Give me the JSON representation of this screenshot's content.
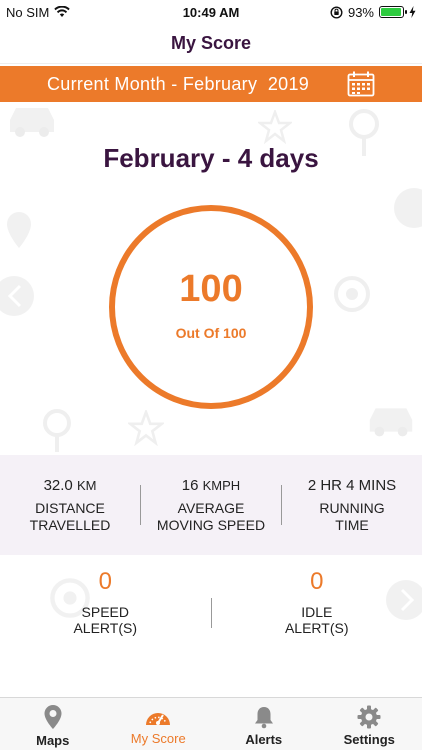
{
  "status_bar": {
    "carrier": "No SIM",
    "time": "10:49 AM",
    "battery_percent": "93%",
    "battery_level": 0.93,
    "battery_color": "#2ecc40"
  },
  "header": {
    "title": "My Score"
  },
  "month_bar": {
    "label": "Current Month - February  2019",
    "calendar_icon": "calendar-icon",
    "color": "#ec7a2a"
  },
  "score": {
    "period_title": "February - 4 days",
    "value": "100",
    "caption": "Out Of 100",
    "accent_color": "#ec7a2a"
  },
  "stats": [
    {
      "value": "32.0",
      "unit": "KM",
      "label_line1": "DISTANCE",
      "label_line2": "TRAVELLED"
    },
    {
      "value": "16",
      "unit": "KMPH",
      "label_line1": "AVERAGE",
      "label_line2": "MOVING SPEED"
    },
    {
      "value": "2 HR 4 MINS",
      "unit": "",
      "label_line1": "RUNNING",
      "label_line2": "TIME"
    }
  ],
  "alerts": [
    {
      "count": "0",
      "label_line1": "SPEED",
      "label_line2": "ALERT(S)"
    },
    {
      "count": "0",
      "label_line1": "IDLE",
      "label_line2": "ALERT(S)"
    }
  ],
  "tabs": [
    {
      "label": "Maps",
      "icon": "map-pin-icon",
      "active": false
    },
    {
      "label": "My Score",
      "icon": "speedometer-icon",
      "active": true
    },
    {
      "label": "Alerts",
      "icon": "bell-icon",
      "active": false
    },
    {
      "label": "Settings",
      "icon": "gear-icon",
      "active": false
    }
  ]
}
